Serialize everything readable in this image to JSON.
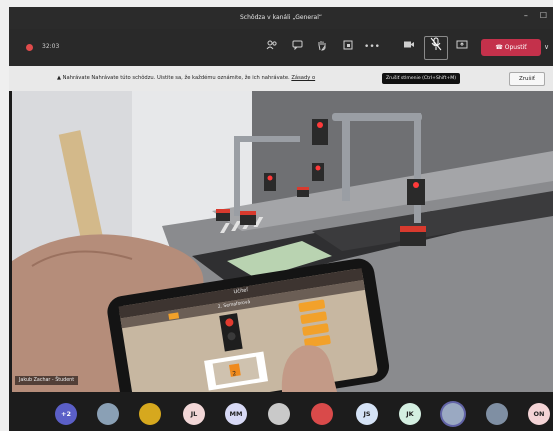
{
  "window": {
    "title": "Schôdza v kanáli „General“",
    "controls": {
      "minimize": "–",
      "maximize": "☐"
    }
  },
  "toolbar": {
    "timer": "32:03",
    "icons": [
      "people-icon",
      "chat-icon",
      "raise-hand-icon",
      "breakout-icon",
      "more-icon",
      "camera-icon",
      "mic-icon",
      "share-icon"
    ],
    "more_label": "•••",
    "leave_label": "Opustiť",
    "leave_caret": "∨",
    "accent_leave": "#c4314b"
  },
  "banner": {
    "icon": "warning-icon",
    "text": "Nahrávate  Nahrávate túto schôdzu. Uistite sa, že každému oznámite, že ich nahrávate.",
    "link": "Zásady o",
    "dismiss_label": "Zrušiť"
  },
  "tooltip": {
    "text": "Zrušiť stlmenie (Ctrl+Shift+M)"
  },
  "video": {
    "presenter": "Jakub Zachar - Študent",
    "phone": {
      "app_title": "Učiteľ",
      "mode_label": "2. Semaforová",
      "signal_value": "2"
    }
  },
  "participants": [
    {
      "initials": "+2",
      "kind": "count",
      "color": "#5b5fc7"
    },
    {
      "initials": "",
      "kind": "photo",
      "color": "#8aa0b5"
    },
    {
      "initials": "",
      "kind": "photo",
      "color": "#d6a81e"
    },
    {
      "initials": "JL",
      "kind": "initials",
      "color": "#f2d7d7"
    },
    {
      "initials": "MM",
      "kind": "initials",
      "color": "#d7d9f5"
    },
    {
      "initials": "",
      "kind": "photo",
      "color": "#c9c9c9"
    },
    {
      "initials": "",
      "kind": "photo",
      "color": "#d94a4a"
    },
    {
      "initials": "JS",
      "kind": "initials",
      "color": "#d5e3f6"
    },
    {
      "initials": "JK",
      "kind": "initials",
      "color": "#d4efe1"
    },
    {
      "initials": "",
      "kind": "photo",
      "color": "#9aa9c2",
      "selected": true
    },
    {
      "initials": "",
      "kind": "photo",
      "color": "#7f8fa3"
    },
    {
      "initials": "ON",
      "kind": "initials",
      "color": "#f4d4d6"
    }
  ]
}
